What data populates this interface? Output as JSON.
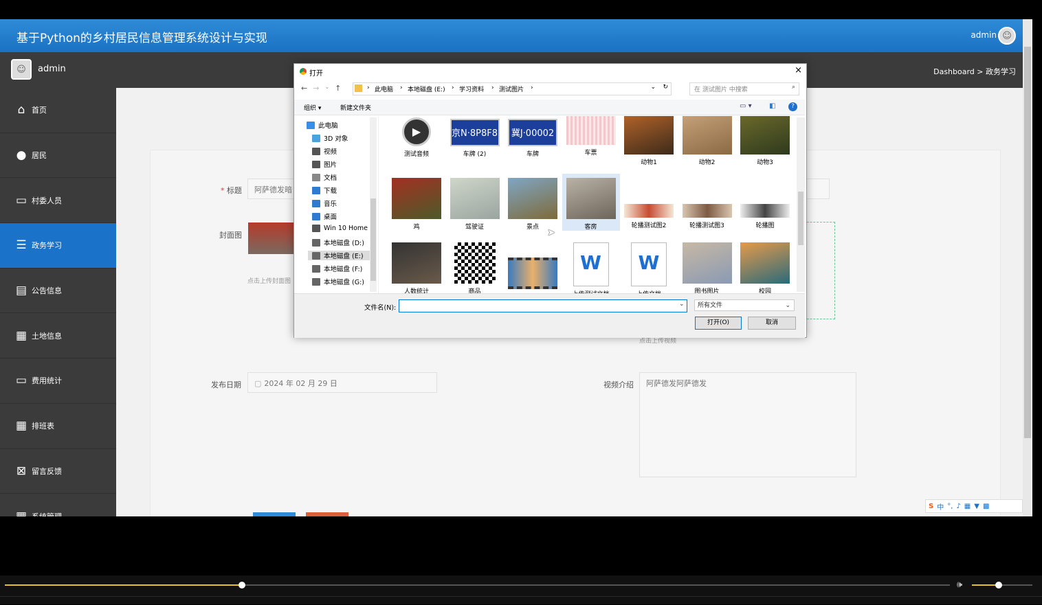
{
  "app": {
    "title": "基于Python的乡村居民信息管理系统设计与实现",
    "user": "admin"
  },
  "sidebar": {
    "user": "admin",
    "items": [
      {
        "label": "首页",
        "icon": "home-icon"
      },
      {
        "label": "居民",
        "icon": "balloon-icon"
      },
      {
        "label": "村委人员",
        "icon": "monitor-icon"
      },
      {
        "label": "政务学习",
        "icon": "list-icon",
        "active": true
      },
      {
        "label": "公告信息",
        "icon": "briefcase-icon"
      },
      {
        "label": "土地信息",
        "icon": "grid-icon"
      },
      {
        "label": "费用统计",
        "icon": "laptop-icon"
      },
      {
        "label": "排班表",
        "icon": "grid-icon"
      },
      {
        "label": "留言反馈",
        "icon": "clipboard-icon"
      },
      {
        "label": "系统管理",
        "icon": "grid-icon"
      }
    ]
  },
  "breadcrumb": {
    "text": "Dashboard > 政务学习"
  },
  "form": {
    "title_label": "标题",
    "title_value": "阿萨德发暗",
    "cover_label": "封面图",
    "cover_hint": "点击上传封面图",
    "video_hint": "点击上传视频",
    "date_label": "发布日期",
    "date_value": "2024 年 02 月 29 日",
    "intro_label": "视频介绍",
    "intro_value": "阿萨德发阿萨德发"
  },
  "dialog": {
    "title": "打开",
    "path": [
      "此电脑",
      "本地磁盘 (E:)",
      "学习资料",
      "测试图片"
    ],
    "search_placeholder": "在 测试图片 中搜索",
    "organize": "组织 ▾",
    "new_folder": "新建文件夹",
    "tree": [
      {
        "label": "此电脑",
        "color": "#3a8ee6"
      },
      {
        "label": "3D 对象",
        "color": "#4aa3df"
      },
      {
        "label": "视频",
        "color": "#555"
      },
      {
        "label": "图片",
        "color": "#555"
      },
      {
        "label": "文档",
        "color": "#888"
      },
      {
        "label": "下载",
        "color": "#2f7bd0"
      },
      {
        "label": "音乐",
        "color": "#2f7bd0"
      },
      {
        "label": "桌面",
        "color": "#2f7bd0"
      },
      {
        "label": "Win 10 Home ›",
        "color": "#555"
      },
      {
        "label": "本地磁盘 (D:)",
        "color": "#666"
      },
      {
        "label": "本地磁盘 (E:)",
        "color": "#666",
        "selected": true
      },
      {
        "label": "本地磁盘 (F:)",
        "color": "#666"
      },
      {
        "label": "本地磁盘 (G:)",
        "color": "#666"
      }
    ],
    "files": [
      {
        "label": "测试音频",
        "kind": "media"
      },
      {
        "label": "车牌 (2)",
        "kind": "plate",
        "text": "京N·8P8F8"
      },
      {
        "label": "车牌",
        "kind": "plate",
        "text": "冀J·00002"
      },
      {
        "label": "车票",
        "kind": "ticket"
      },
      {
        "label": "动物1",
        "kind": "photo",
        "c1": "#b5652a",
        "c2": "#3d2a1a"
      },
      {
        "label": "动物2",
        "kind": "photo",
        "c1": "#c8a27a",
        "c2": "#8a6a44"
      },
      {
        "label": "动物3",
        "kind": "photo",
        "c1": "#6d6a2c",
        "c2": "#2e3a1d"
      },
      {
        "label": "鸡",
        "kind": "photo",
        "c1": "#a33020",
        "c2": "#4c5a2a"
      },
      {
        "label": "驾驶证",
        "kind": "photo",
        "c1": "#cfd6c9",
        "c2": "#9aa5a0"
      },
      {
        "label": "景点",
        "kind": "photo",
        "c1": "#7fa6c4",
        "c2": "#7e6a3a"
      },
      {
        "label": "客房",
        "kind": "photo",
        "c1": "#b9b2a6",
        "c2": "#6e655a",
        "selected": true
      },
      {
        "label": "轮播测试图2",
        "kind": "strip",
        "c1": "#f4e7d5",
        "c2": "#c74c34"
      },
      {
        "label": "轮播测试图3",
        "kind": "strip",
        "c1": "#d9c6b0",
        "c2": "#7d5a44"
      },
      {
        "label": "轮播图",
        "kind": "strip",
        "c1": "#eeeeee",
        "c2": "#444444"
      },
      {
        "label": "人数统计",
        "kind": "photo",
        "c1": "#333333",
        "c2": "#6a5a4a"
      },
      {
        "label": "商品",
        "kind": "qr"
      },
      {
        "label": "上传测试视频",
        "kind": "film"
      },
      {
        "label": "上传测试文档",
        "kind": "word"
      },
      {
        "label": "上传文档",
        "kind": "word"
      },
      {
        "label": "图书图片",
        "kind": "photo",
        "c1": "#c7b8a5",
        "c2": "#8a9ab3"
      },
      {
        "label": "校园",
        "kind": "photo",
        "c1": "#e59a4a",
        "c2": "#2b6a7a"
      }
    ],
    "filename_label": "文件名(N):",
    "filename_value": "",
    "filetype": "所有文件",
    "open_btn": "打开(O)",
    "cancel_btn": "取消"
  },
  "ime": {
    "label": "中"
  },
  "colors": {
    "header": "#1a72c2",
    "sidebar": "#3b3b3b",
    "active": "#1a73c8"
  }
}
